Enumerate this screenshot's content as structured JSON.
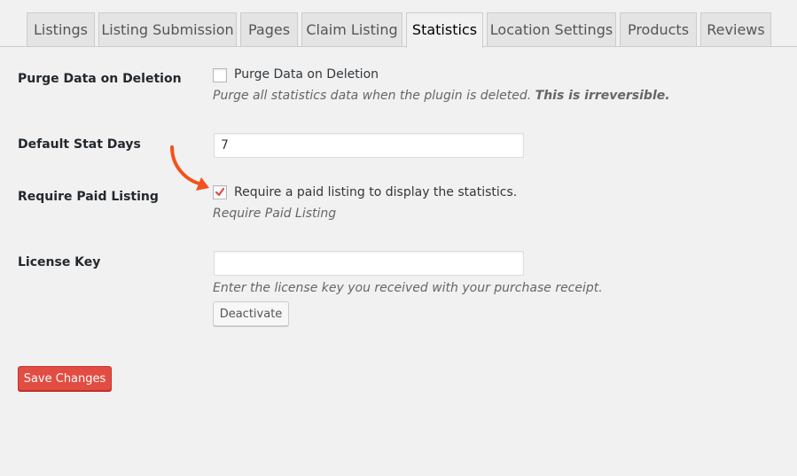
{
  "tabs": [
    {
      "label": "Listings"
    },
    {
      "label": "Listing Submission"
    },
    {
      "label": "Pages"
    },
    {
      "label": "Claim Listing"
    },
    {
      "label": "Statistics",
      "active": true
    },
    {
      "label": "Location Settings"
    },
    {
      "label": "Products"
    },
    {
      "label": "Reviews"
    }
  ],
  "settings": {
    "purge": {
      "label": "Purge Data on Deletion",
      "checkbox_label": "Purge Data on Deletion",
      "checked": false,
      "description": "Purge all statistics data when the plugin is deleted.",
      "description_strong": "This is irreversible."
    },
    "stat_days": {
      "label": "Default Stat Days",
      "value": "7"
    },
    "paid": {
      "label": "Require Paid Listing",
      "checkbox_label": "Require a paid listing to display the statistics.",
      "checked": true,
      "description": "Require Paid Listing"
    },
    "license": {
      "label": "License Key",
      "value": "",
      "description": "Enter the license key you received with your purchase receipt.",
      "deactivate_label": "Deactivate"
    }
  },
  "save_label": "Save Changes",
  "colors": {
    "accent_arrow": "#f4511e",
    "checkmark": "#e14d43",
    "primary_button": "#e14d43"
  },
  "icons": {
    "annotation": "curved-arrow-icon",
    "check": "checkmark-icon"
  }
}
